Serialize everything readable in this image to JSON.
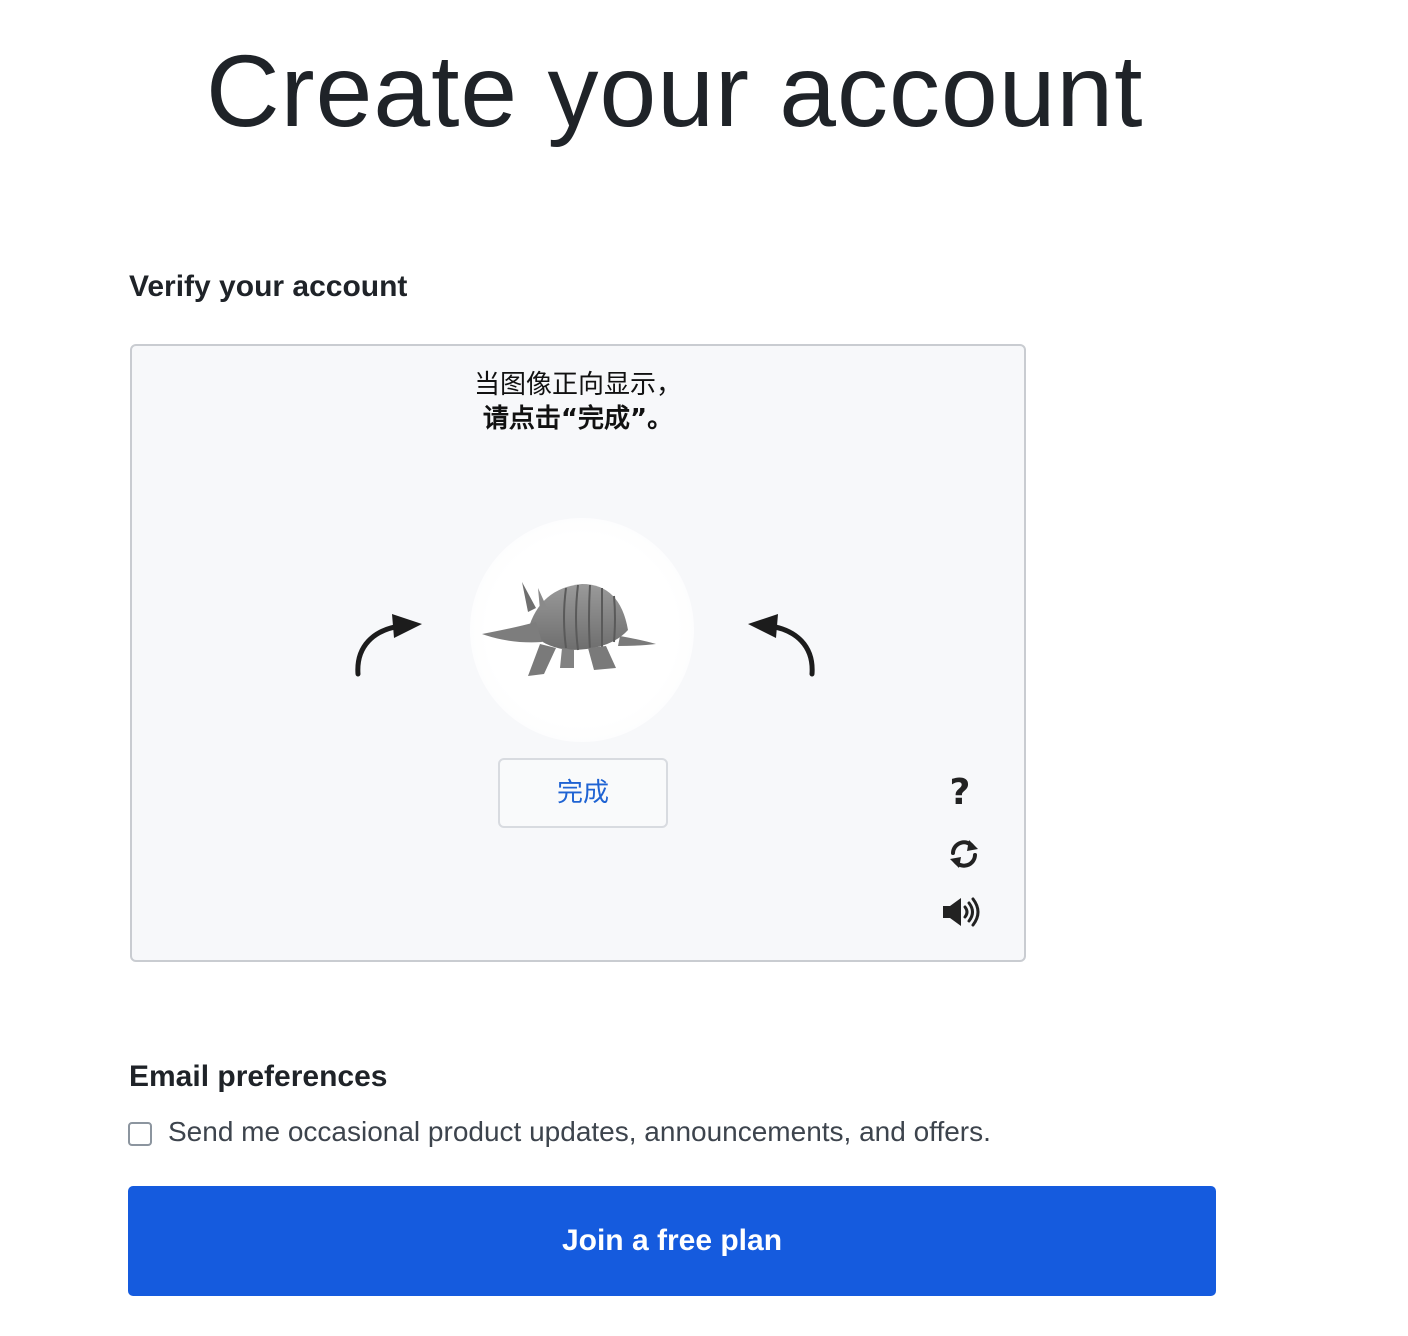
{
  "page": {
    "title": "Create your account"
  },
  "verify": {
    "heading": "Verify your account",
    "instruction_line1": "当图像正向显示，",
    "instruction_line2": "请点击“完成”。",
    "done_label": "完成",
    "help_symbol": "?",
    "icons": {
      "rotate_left": "curved-arrow-left-icon",
      "rotate_right": "curved-arrow-right-icon",
      "help": "question-mark-icon",
      "refresh": "refresh-icon",
      "audio": "speaker-icon"
    }
  },
  "email": {
    "heading": "Email preferences",
    "opt_in_label": "Send me occasional product updates, announcements, and offers.",
    "opt_in_checked": false
  },
  "submit": {
    "label": "Join a free plan"
  },
  "colors": {
    "primary_button": "#155bde",
    "done_text": "#1f63d3",
    "captcha_bg": "#f7f8fa"
  }
}
